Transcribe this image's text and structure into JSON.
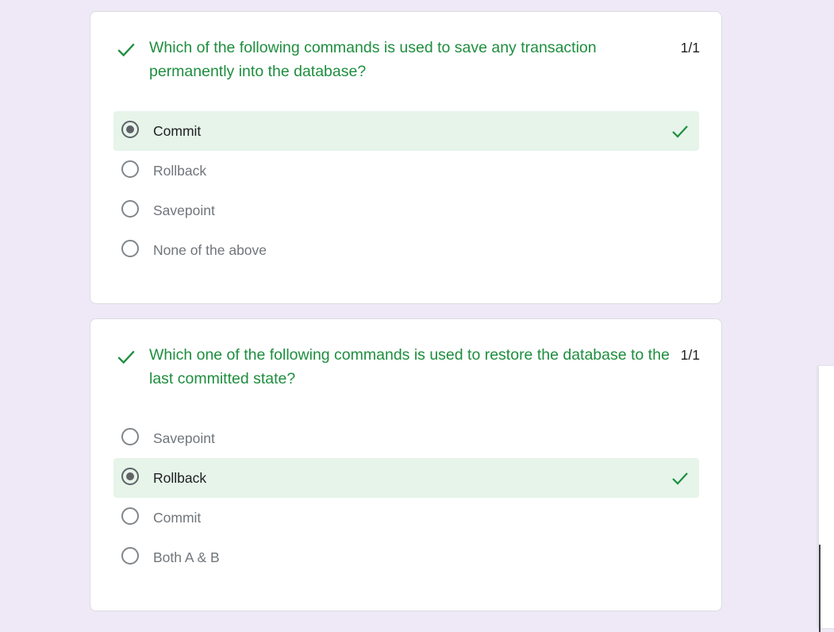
{
  "colors": {
    "background": "#efe9f7",
    "correct": "#1e8e3e",
    "correct_bg": "#e6f4ea",
    "radio": "#5f6368"
  },
  "questions": [
    {
      "text": "Which of the following commands is used to save any transaction permanently into the database?",
      "score": "1/1",
      "status_icon": "checkmark-icon",
      "options": [
        {
          "label": "Commit",
          "selected": true,
          "correct": true
        },
        {
          "label": "Rollback",
          "selected": false,
          "correct": false
        },
        {
          "label": "Savepoint",
          "selected": false,
          "correct": false
        },
        {
          "label": "None of the above",
          "selected": false,
          "correct": false
        }
      ]
    },
    {
      "text": "Which one of the following commands is used to restore the database to the last committed state?",
      "score": "1/1",
      "status_icon": "checkmark-icon",
      "options": [
        {
          "label": "Savepoint",
          "selected": false,
          "correct": false
        },
        {
          "label": "Rollback",
          "selected": true,
          "correct": true
        },
        {
          "label": "Commit",
          "selected": false,
          "correct": false
        },
        {
          "label": "Both A & B",
          "selected": false,
          "correct": false
        }
      ]
    }
  ]
}
